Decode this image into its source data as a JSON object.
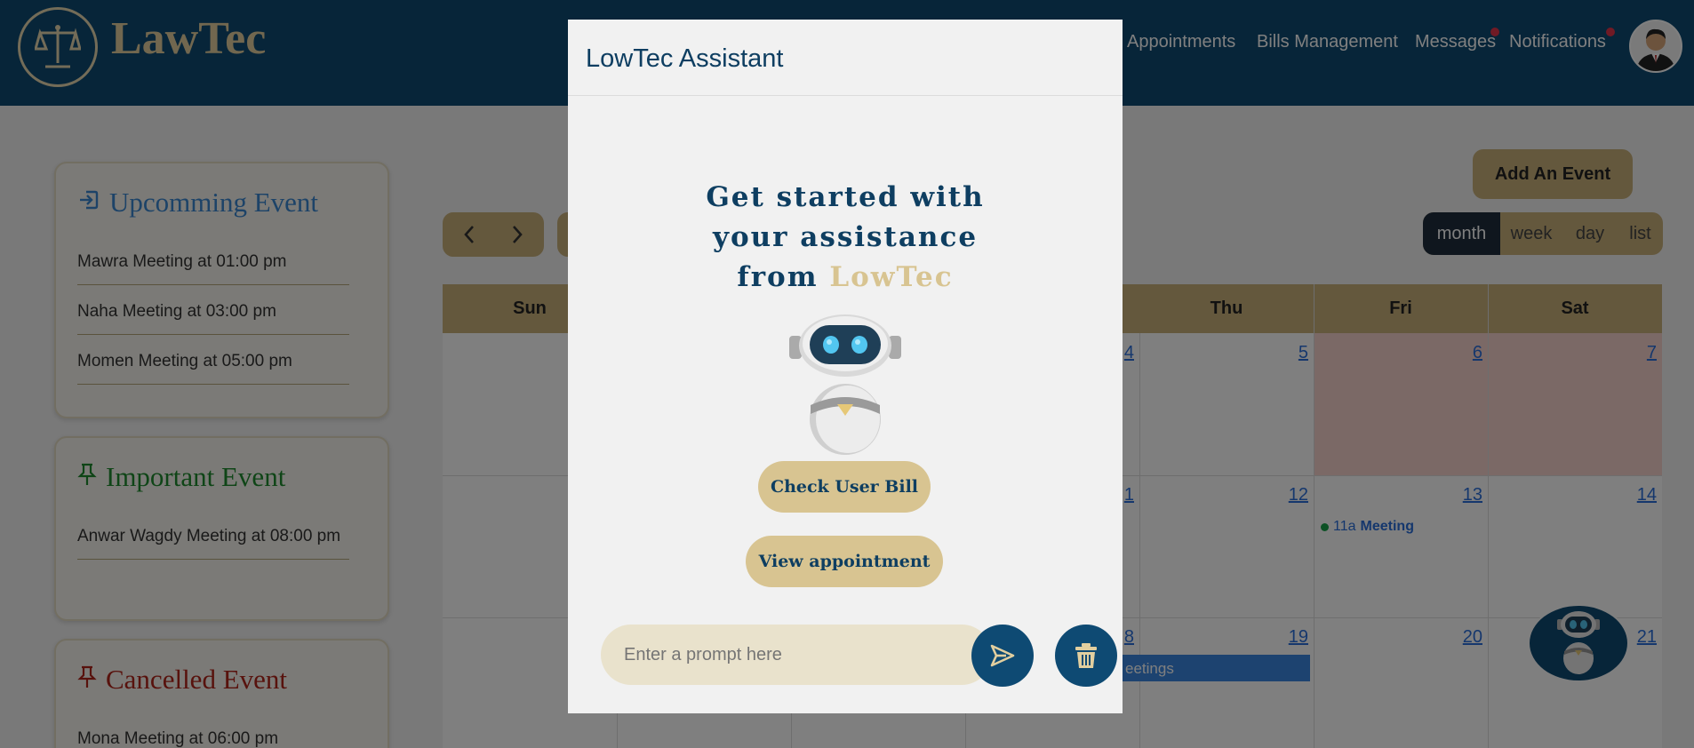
{
  "header": {
    "logo_text": "LawTec",
    "nav": [
      {
        "label": "Appointments"
      },
      {
        "label": "Bills Management"
      },
      {
        "label": "Messages"
      },
      {
        "label": "Notifications"
      }
    ]
  },
  "sidebar": {
    "upcoming": {
      "title": "Upcomming Event",
      "items": [
        "Mawra Meeting at 01:00 pm",
        "Naha Meeting at 03:00 pm",
        "Momen Meeting at 05:00 pm"
      ]
    },
    "important": {
      "title": "Important Event",
      "items": [
        "Anwar Wagdy Meeting at 08:00 pm"
      ]
    },
    "cancelled": {
      "title": "Cancelled Event",
      "items": [
        "Mona Meeting at 06:00 pm"
      ]
    }
  },
  "calendar": {
    "add_event_label": "Add An Event",
    "views": [
      "month",
      "week",
      "day",
      "list"
    ],
    "active_view": "month",
    "days": [
      "Sun",
      "Thu",
      "Fri",
      "Sat"
    ],
    "day_numbers": [
      "4",
      "5",
      "6",
      "7",
      "1",
      "12",
      "13",
      "14",
      "8",
      "19",
      "20",
      "21"
    ],
    "events": [
      {
        "time": "11a",
        "title": "Meeting",
        "color": "#1aa34a"
      },
      {
        "title": "eetings",
        "color": "#3a87e0"
      }
    ]
  },
  "assistant": {
    "title": "LowTec Assistant",
    "hero_line1": "Get started with",
    "hero_line2": "your assistance",
    "hero_line3_prefix": "from",
    "hero_brand": "LowTec",
    "check_bill_label": "Check User Bill",
    "view_appointment_label": "View appointment",
    "prompt_placeholder": "Enter a prompt here"
  },
  "colors": {
    "primary": "#0e4a73",
    "gold": "#c9b07a",
    "accent_red": "#e0344b"
  }
}
